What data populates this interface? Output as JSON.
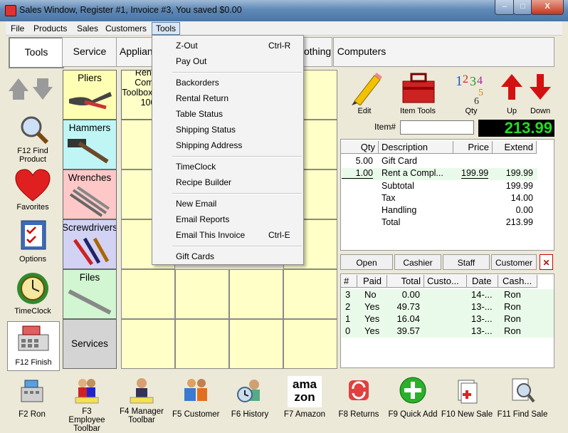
{
  "window": {
    "title": "Sales Window,  Register #1,  Invoice #3, You saved $0.00",
    "minimize": "–",
    "maximize": "□",
    "close": "X"
  },
  "menu": [
    "File",
    "Products",
    "Sales",
    "Customers",
    "Tools"
  ],
  "category_tabs": [
    "Tools",
    "Service",
    "Applian",
    "othing",
    "Computers"
  ],
  "left_buttons": {
    "find_product": "F12 Find Product",
    "favorites": "Favorites",
    "options": "Options",
    "timeclock": "TimeClock",
    "finish": "F12 Finish"
  },
  "products": [
    {
      "label": "Pliers",
      "color": "#ffffb4"
    },
    {
      "label": "Hammers",
      "color": "#bff5f5"
    },
    {
      "label": "Wrenches",
      "color": "#ffc8c8"
    },
    {
      "label": "Screwdrivers",
      "color": "#d2d2f5"
    },
    {
      "label": "Files",
      "color": "#d2f5d2"
    },
    {
      "label": "Services",
      "color": "#d4d4d4"
    }
  ],
  "partial_product": "Rental Compr Toolbox of To 100",
  "tools_menu": {
    "groups": [
      [
        {
          "label": "Z-Out",
          "shortcut": "Ctrl-R"
        },
        {
          "label": "Pay Out",
          "shortcut": ""
        }
      ],
      [
        {
          "label": "Backorders",
          "shortcut": ""
        },
        {
          "label": "Rental Return",
          "shortcut": ""
        },
        {
          "label": "Table Status",
          "shortcut": ""
        },
        {
          "label": "Shipping Status",
          "shortcut": ""
        },
        {
          "label": "Shipping Address",
          "shortcut": ""
        }
      ],
      [
        {
          "label": "TimeClock",
          "shortcut": ""
        },
        {
          "label": "Recipe Builder",
          "shortcut": ""
        }
      ],
      [
        {
          "label": "New Email",
          "shortcut": ""
        },
        {
          "label": "Email Reports",
          "shortcut": ""
        },
        {
          "label": "Email This Invoice",
          "shortcut": "Ctrl-E"
        }
      ],
      [
        {
          "label": "Gift Cards",
          "shortcut": ""
        }
      ]
    ]
  },
  "action_icons": {
    "edit": "Edit",
    "item_tools": "Item Tools",
    "qty": "Qty",
    "up": "Up",
    "down": "Down"
  },
  "item_field": {
    "label": "Item#",
    "value": ""
  },
  "total_display": "213.99",
  "line_items": {
    "headers": [
      "Qty",
      "Description",
      "Price",
      "Extend"
    ],
    "rows": [
      {
        "qty": "5.00",
        "description": "Gift Card",
        "price": "",
        "extend": ""
      },
      {
        "qty": "1.00",
        "description": "Rent a Compl...",
        "price": "199.99",
        "extend": "199.99"
      }
    ],
    "summary": [
      {
        "label": "Subtotal",
        "value": "199.99"
      },
      {
        "label": "Tax",
        "value": "14.00"
      },
      {
        "label": "Handling",
        "value": "0.00"
      },
      {
        "label": "Total",
        "value": "213.99"
      }
    ]
  },
  "invoice_tabs": [
    "Open",
    "Cashier",
    "Staff",
    "Customer"
  ],
  "invoices": {
    "headers": [
      "#",
      "Paid",
      "Total",
      "Custo...",
      "Date",
      "Cash..."
    ],
    "rows": [
      {
        "num": "3",
        "paid": "No",
        "total": "0.00",
        "customer": "",
        "date": "14-...",
        "cashier": "Ron"
      },
      {
        "num": "2",
        "paid": "Yes",
        "total": "49.73",
        "customer": "",
        "date": "13-...",
        "cashier": "Ron"
      },
      {
        "num": "1",
        "paid": "Yes",
        "total": "16.04",
        "customer": "",
        "date": "13-...",
        "cashier": "Ron"
      },
      {
        "num": "0",
        "paid": "Yes",
        "total": "39.57",
        "customer": "",
        "date": "13-...",
        "cashier": "Ron"
      }
    ]
  },
  "toolbar": [
    "F2 Ron",
    "F3 Employee Toolbar",
    "F4 Manager Toolbar",
    "F5 Customer",
    "F6 History",
    "F7 Amazon",
    "F8 Returns",
    "F9 Quick Add",
    "F10 New Sale",
    "F11 Find Sale"
  ],
  "amazon_logo": "amazon",
  "colors": {
    "accent_green": "#22dd22",
    "total_bg": "#000000",
    "grid_yellow": "#ffffc8"
  }
}
